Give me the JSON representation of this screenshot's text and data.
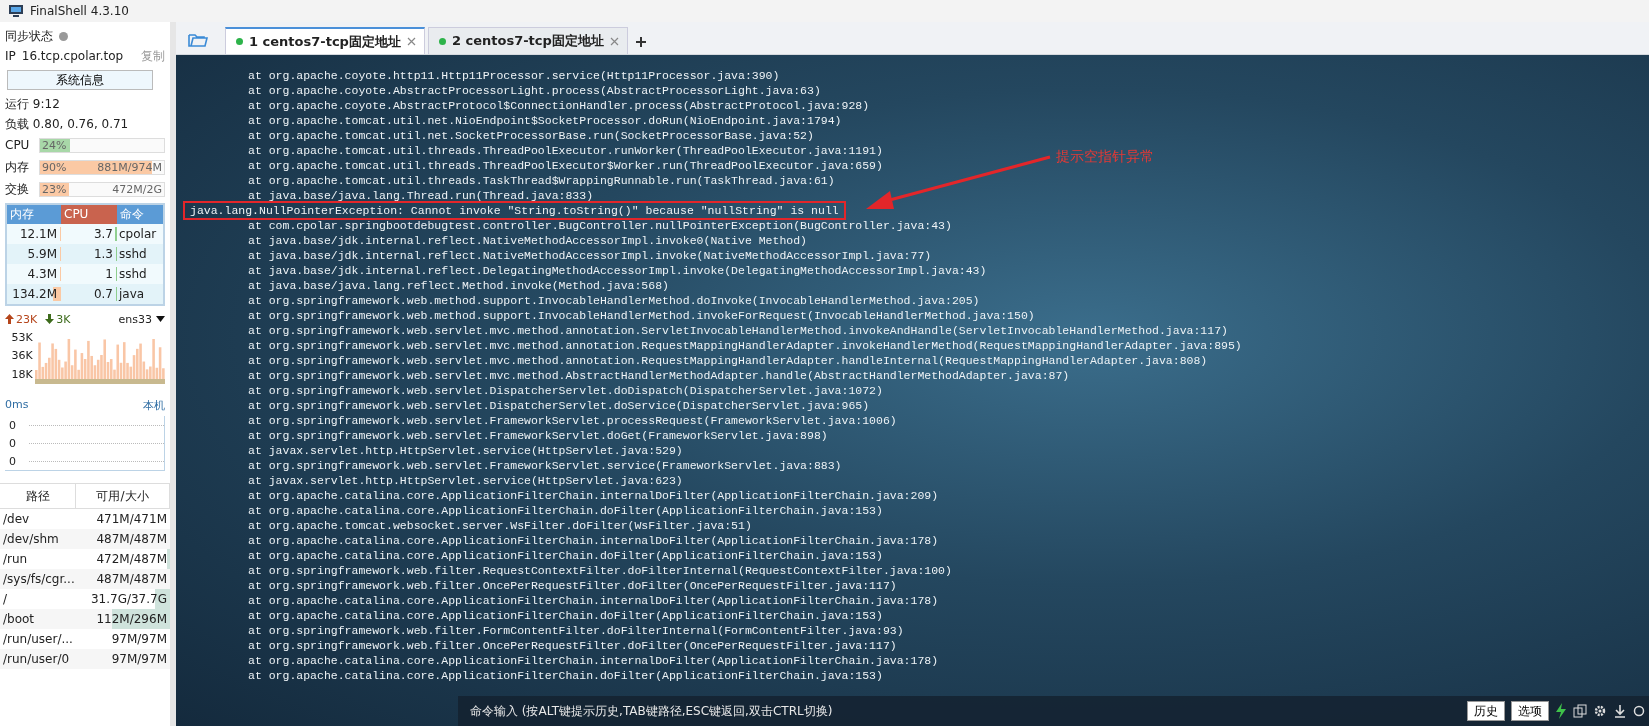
{
  "window": {
    "title": "FinalShell 4.3.10"
  },
  "sidebar": {
    "sync_label": "同步状态",
    "ip": {
      "label": "IP",
      "value": "16.tcp.cpolar.top",
      "copy": "复制"
    },
    "sysinfo_button": "系统信息",
    "uptime": "运行 9:12",
    "load": "负载 0.80, 0.76, 0.71",
    "meters": [
      {
        "label": "CPU",
        "percent": "24%",
        "level": 0.24,
        "color": "#a8d8a8"
      },
      {
        "label": "内存",
        "percent": "90%",
        "detail": "881M/974M",
        "level": 0.9,
        "color": "#fbc9a4"
      },
      {
        "label": "交换",
        "percent": "23%",
        "detail": "472M/2G",
        "level": 0.23,
        "color": "#fbc9a4"
      }
    ],
    "processes": {
      "columns": [
        {
          "label": "内存",
          "selected": false
        },
        {
          "label": "CPU",
          "selected": true
        },
        {
          "label": "命令",
          "selected": false
        }
      ],
      "rows": [
        {
          "mem": {
            "text": "12.1M",
            "level": 0.02
          },
          "cpu": {
            "text": "3.7",
            "level": 0.04
          },
          "command": "cpolar"
        },
        {
          "mem": {
            "text": "5.9M",
            "level": 0.01
          },
          "cpu": {
            "text": "1.3",
            "level": 0.02
          },
          "command": "sshd"
        },
        {
          "mem": {
            "text": "4.3M",
            "level": 0.01
          },
          "cpu": {
            "text": "1",
            "level": 0.01
          },
          "command": "sshd"
        },
        {
          "mem": {
            "text": "134.2M",
            "level": 0.14
          },
          "cpu": {
            "text": "0.7",
            "level": 0.01
          },
          "command": "java"
        }
      ]
    },
    "network": {
      "up": "23K",
      "down": "3K",
      "interface": "ens33",
      "axis_labels": [
        "53K",
        "36K",
        "18K"
      ]
    },
    "ping": {
      "latency": "0ms",
      "host": "本机",
      "axis_labels": [
        "0",
        "0",
        "0"
      ]
    },
    "disks": {
      "columns": [
        "路径",
        "可用/大小"
      ],
      "rows": [
        {
          "path": "/dev",
          "size": "471M/471M",
          "level": 0
        },
        {
          "path": "/dev/shm",
          "size": "487M/487M",
          "level": 0
        },
        {
          "path": "/run",
          "size": "472M/487M",
          "level": 0.03
        },
        {
          "path": "/sys/fs/cgr...",
          "size": "487M/487M",
          "level": 0
        },
        {
          "path": "/",
          "size": "31.7G/37.7G",
          "level": 0.16
        },
        {
          "path": "/boot",
          "size": "112M/296M",
          "level": 0.62
        },
        {
          "path": "/run/user/...",
          "size": "97M/97M",
          "level": 0
        },
        {
          "path": "/run/user/0",
          "size": "97M/97M",
          "level": 0
        }
      ]
    }
  },
  "tabs": [
    {
      "label": "1 centos7-tcp固定地址",
      "selected": true
    },
    {
      "label": "2 centos7-tcp固定地址",
      "selected": false
    }
  ],
  "terminal": {
    "lines": [
      {
        "kind": "frame",
        "text": "at org.apache.coyote.http11.Http11Processor.service(Http11Processor.java:390)"
      },
      {
        "kind": "frame",
        "text": "at org.apache.coyote.AbstractProcessorLight.process(AbstractProcessorLight.java:63)"
      },
      {
        "kind": "frame",
        "text": "at org.apache.coyote.AbstractProtocol$ConnectionHandler.process(AbstractProtocol.java:928)"
      },
      {
        "kind": "frame",
        "text": "at org.apache.tomcat.util.net.NioEndpoint$SocketProcessor.doRun(NioEndpoint.java:1794)"
      },
      {
        "kind": "frame",
        "text": "at org.apache.tomcat.util.net.SocketProcessorBase.run(SocketProcessorBase.java:52)"
      },
      {
        "kind": "frame",
        "text": "at org.apache.tomcat.util.threads.ThreadPoolExecutor.runWorker(ThreadPoolExecutor.java:1191)"
      },
      {
        "kind": "frame",
        "text": "at org.apache.tomcat.util.threads.ThreadPoolExecutor$Worker.run(ThreadPoolExecutor.java:659)"
      },
      {
        "kind": "frame",
        "text": "at org.apache.tomcat.util.threads.TaskThread$WrappingRunnable.run(TaskThread.java:61)"
      },
      {
        "kind": "frame",
        "text": "at java.base/java.lang.Thread.run(Thread.java:833)"
      },
      {
        "kind": "exception",
        "text": "java.lang.NullPointerException: Cannot invoke \"String.toString()\" because \"nullString\" is null"
      },
      {
        "kind": "frame",
        "text": "at com.cpolar.springbootdebugtest.controller.BugController.nullPointerException(BugController.java:43)"
      },
      {
        "kind": "frame",
        "text": "at java.base/jdk.internal.reflect.NativeMethodAccessorImpl.invoke0(Native Method)"
      },
      {
        "kind": "frame",
        "text": "at java.base/jdk.internal.reflect.NativeMethodAccessorImpl.invoke(NativeMethodAccessorImpl.java:77)"
      },
      {
        "kind": "frame",
        "text": "at java.base/jdk.internal.reflect.DelegatingMethodAccessorImpl.invoke(DelegatingMethodAccessorImpl.java:43)"
      },
      {
        "kind": "frame",
        "text": "at java.base/java.lang.reflect.Method.invoke(Method.java:568)"
      },
      {
        "kind": "frame",
        "text": "at org.springframework.web.method.support.InvocableHandlerMethod.doInvoke(InvocableHandlerMethod.java:205)"
      },
      {
        "kind": "frame",
        "text": "at org.springframework.web.method.support.InvocableHandlerMethod.invokeForRequest(InvocableHandlerMethod.java:150)"
      },
      {
        "kind": "frame",
        "text": "at org.springframework.web.servlet.mvc.method.annotation.ServletInvocableHandlerMethod.invokeAndHandle(ServletInvocableHandlerMethod.java:117)"
      },
      {
        "kind": "frame",
        "text": "at org.springframework.web.servlet.mvc.method.annotation.RequestMappingHandlerAdapter.invokeHandlerMethod(RequestMappingHandlerAdapter.java:895)"
      },
      {
        "kind": "frame",
        "text": "at org.springframework.web.servlet.mvc.method.annotation.RequestMappingHandlerAdapter.handleInternal(RequestMappingHandlerAdapter.java:808)"
      },
      {
        "kind": "frame",
        "text": "at org.springframework.web.servlet.mvc.method.AbstractHandlerMethodAdapter.handle(AbstractHandlerMethodAdapter.java:87)"
      },
      {
        "kind": "frame",
        "text": "at org.springframework.web.servlet.DispatcherServlet.doDispatch(DispatcherServlet.java:1072)"
      },
      {
        "kind": "frame",
        "text": "at org.springframework.web.servlet.DispatcherServlet.doService(DispatcherServlet.java:965)"
      },
      {
        "kind": "frame",
        "text": "at org.springframework.web.servlet.FrameworkServlet.processRequest(FrameworkServlet.java:1006)"
      },
      {
        "kind": "frame",
        "text": "at org.springframework.web.servlet.FrameworkServlet.doGet(FrameworkServlet.java:898)"
      },
      {
        "kind": "frame",
        "text": "at javax.servlet.http.HttpServlet.service(HttpServlet.java:529)"
      },
      {
        "kind": "frame",
        "text": "at org.springframework.web.servlet.FrameworkServlet.service(FrameworkServlet.java:883)"
      },
      {
        "kind": "frame",
        "text": "at javax.servlet.http.HttpServlet.service(HttpServlet.java:623)"
      },
      {
        "kind": "frame",
        "text": "at org.apache.catalina.core.ApplicationFilterChain.internalDoFilter(ApplicationFilterChain.java:209)"
      },
      {
        "kind": "frame",
        "text": "at org.apache.catalina.core.ApplicationFilterChain.doFilter(ApplicationFilterChain.java:153)"
      },
      {
        "kind": "frame",
        "text": "at org.apache.tomcat.websocket.server.WsFilter.doFilter(WsFilter.java:51)"
      },
      {
        "kind": "frame",
        "text": "at org.apache.catalina.core.ApplicationFilterChain.internalDoFilter(ApplicationFilterChain.java:178)"
      },
      {
        "kind": "frame",
        "text": "at org.apache.catalina.core.ApplicationFilterChain.doFilter(ApplicationFilterChain.java:153)"
      },
      {
        "kind": "frame",
        "text": "at org.springframework.web.filter.RequestContextFilter.doFilterInternal(RequestContextFilter.java:100)"
      },
      {
        "kind": "frame",
        "text": "at org.springframework.web.filter.OncePerRequestFilter.doFilter(OncePerRequestFilter.java:117)"
      },
      {
        "kind": "frame",
        "text": "at org.apache.catalina.core.ApplicationFilterChain.internalDoFilter(ApplicationFilterChain.java:178)"
      },
      {
        "kind": "frame",
        "text": "at org.apache.catalina.core.ApplicationFilterChain.doFilter(ApplicationFilterChain.java:153)"
      },
      {
        "kind": "frame",
        "text": "at org.springframework.web.filter.FormContentFilter.doFilterInternal(FormContentFilter.java:93)"
      },
      {
        "kind": "frame",
        "text": "at org.springframework.web.filter.OncePerRequestFilter.doFilter(OncePerRequestFilter.java:117)"
      },
      {
        "kind": "frame",
        "text": "at org.apache.catalina.core.ApplicationFilterChain.internalDoFilter(ApplicationFilterChain.java:178)"
      },
      {
        "kind": "frame",
        "text": "at org.apache.catalina.core.ApplicationFilterChain.doFilter(ApplicationFilterChain.java:153)"
      }
    ]
  },
  "annotation": {
    "text": "提示空指针异常"
  },
  "command_bar": {
    "placeholder": "命令输入 (按ALT键提示历史,TAB键路径,ESC键返回,双击CTRL切换)",
    "buttons": [
      "历史",
      "选项"
    ]
  }
}
